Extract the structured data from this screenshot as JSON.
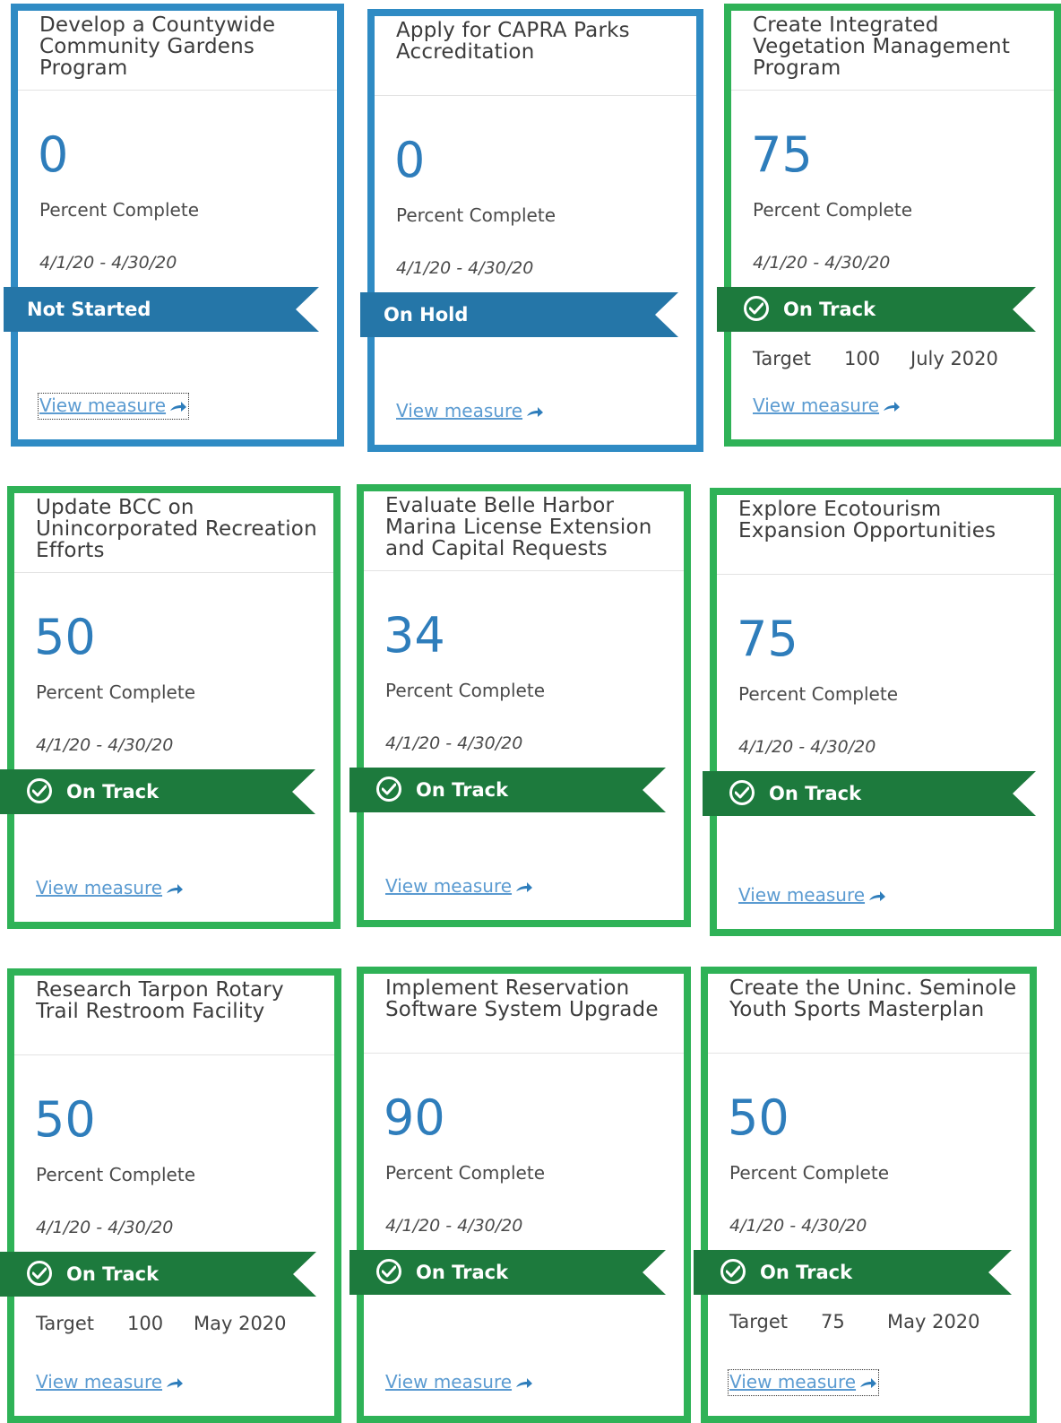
{
  "colors": {
    "blue_border": "#2f8bc4",
    "green_border": "#2fb257",
    "value_blue": "#2e7dbb",
    "ribbon_blue": "#2576a8",
    "ribbon_green": "#1d7a3d",
    "link_blue": "#5b9bd1"
  },
  "common": {
    "percent_label": "Percent Complete",
    "date_range": "4/1/20 - 4/30/20",
    "view_link": "View measure",
    "target_label": "Target"
  },
  "cards": [
    {
      "title": "Develop a Countywide Community Gardens Program",
      "percent": "0",
      "status": "Not Started",
      "status_icon": "none"
    },
    {
      "title": "Apply for CAPRA Parks Accreditation",
      "percent": "0",
      "status": "On Hold",
      "status_icon": "none"
    },
    {
      "title": "Create Integrated Vegetation Management Program",
      "percent": "75",
      "status": "On Track",
      "status_icon": "check-circle-icon",
      "target_value": "100",
      "target_date": "July 2020"
    },
    {
      "title": "Update BCC on Unincorporated Recreation Efforts",
      "percent": "50",
      "status": "On Track",
      "status_icon": "check-circle-icon"
    },
    {
      "title": "Evaluate Belle Harbor Marina License Extension and Capital Requests",
      "percent": "34",
      "status": "On Track",
      "status_icon": "check-circle-icon"
    },
    {
      "title": "Explore Ecotourism Expansion Opportunities",
      "percent": "75",
      "status": "On Track",
      "status_icon": "check-circle-icon"
    },
    {
      "title": "Research Tarpon Rotary Trail Restroom Facility",
      "percent": "50",
      "status": "On Track",
      "status_icon": "check-circle-icon",
      "target_value": "100",
      "target_date": "May 2020"
    },
    {
      "title": "Implement Reservation Software System Upgrade",
      "percent": "90",
      "status": "On Track",
      "status_icon": "check-circle-icon"
    },
    {
      "title": "Create the Uninc. Seminole Youth Sports Masterplan",
      "percent": "50",
      "status": "On Track",
      "status_icon": "check-circle-icon",
      "target_value": "75",
      "target_date": "May 2020"
    }
  ]
}
